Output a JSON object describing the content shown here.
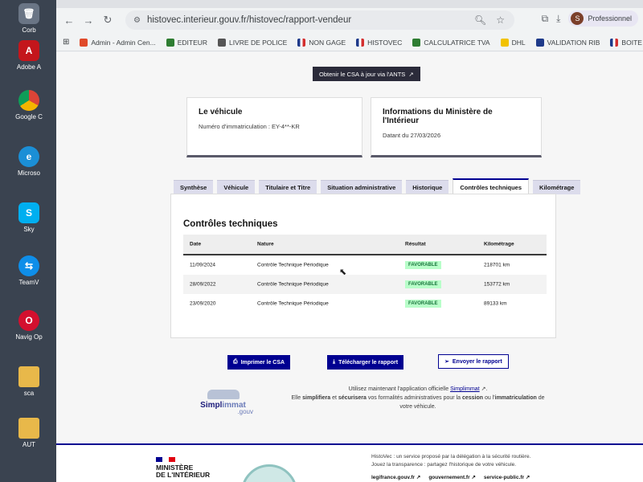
{
  "desktop": {
    "items": [
      {
        "label": "Corb",
        "icon": "trash-icon"
      },
      {
        "label": "Adobe A",
        "icon": "acrobat-icon"
      },
      {
        "label": "Google C",
        "icon": "chrome-icon"
      },
      {
        "label": "Microso",
        "icon": "edge-icon"
      },
      {
        "label": "Sky",
        "icon": "skype-icon"
      },
      {
        "label": "TeamV",
        "icon": "teamviewer-icon"
      },
      {
        "label": "Navig Op",
        "icon": "opera-icon"
      },
      {
        "label": "sca",
        "icon": "folder-icon"
      },
      {
        "label": "AUT",
        "icon": "folder-icon"
      }
    ]
  },
  "browser": {
    "url": "histovec.interieur.gouv.fr/histovec/rapport-vendeur",
    "profile_label": "Professionnel",
    "profile_initial": "S",
    "bookmarks": [
      {
        "label": "Admin - Admin Cen...",
        "color": "#e04a2a"
      },
      {
        "label": "EDITEUR",
        "color": "#2e7d32"
      },
      {
        "label": "LIVRE DE POLICE",
        "color": "#555555"
      },
      {
        "label": "NON GAGE",
        "color": "#1e3a8a"
      },
      {
        "label": "HISTOVEC",
        "color": "#1e3a8a"
      },
      {
        "label": "CALCULATRICE TVA",
        "color": "#2e7d32"
      },
      {
        "label": "DHL",
        "color": "#f2c200"
      },
      {
        "label": "VALIDATION RIB",
        "color": "#1e3a8a"
      },
      {
        "label": "BOITE A OUTILS",
        "color": "#1e3a8a"
      }
    ]
  },
  "page": {
    "csa_button": "Obtenir le CSA à jour via l'ANTS",
    "vehicle_card": {
      "title": "Le véhicule",
      "text": "Numéro d'immatriculation : EY-4**-KR"
    },
    "ministry_card": {
      "title": "Informations du Ministère de l'Intérieur",
      "text": "Datant du 27/03/2026"
    },
    "tabs": [
      {
        "label": "Synthèse",
        "active": false
      },
      {
        "label": "Véhicule",
        "active": false
      },
      {
        "label": "Titulaire et Titre",
        "active": false
      },
      {
        "label": "Situation administrative",
        "active": false
      },
      {
        "label": "Historique",
        "active": false
      },
      {
        "label": "Contrôles techniques",
        "active": true
      },
      {
        "label": "Kilométrage",
        "active": false
      }
    ],
    "ct": {
      "heading": "Contrôles techniques",
      "headers": {
        "date": "Date",
        "nature": "Nature",
        "result": "Résultat",
        "km": "Kilométrage"
      },
      "rows": [
        {
          "date": "11/09/2024",
          "nature": "Contrôle Technique Périodique",
          "result": "FAVORABLE",
          "km": "218701 km"
        },
        {
          "date": "28/09/2022",
          "nature": "Contrôle Technique Périodique",
          "result": "FAVORABLE",
          "km": "153772 km"
        },
        {
          "date": "23/09/2020",
          "nature": "Contrôle Technique Périodique",
          "result": "FAVORABLE",
          "km": "89133 km"
        }
      ]
    },
    "actions": {
      "print": "Imprimer le CSA",
      "download": "Télécharger le rapport",
      "send": "Envoyer le rapport"
    },
    "simplimmat": {
      "logo_main": "Simpl",
      "logo_accent": "immat",
      "logo_suffix": ".gouv",
      "line1_pre": "Utilisez maintenant l'application officielle ",
      "line1_link": "Simplimmat",
      "line1_post": ".",
      "line2_a": "Elle ",
      "line2_b": "simplifiera",
      "line2_c": " et ",
      "line2_d": "sécurisera",
      "line2_e": " vos formalités administratives pour la ",
      "line2_f": "cession",
      "line2_g": " ou l'",
      "line2_h": "immatriculation",
      "line2_i": " de",
      "line3": "votre véhicule."
    },
    "footer": {
      "ministry_line1": "MINISTÈRE",
      "ministry_line2": "DE L'INTÉRIEUR",
      "desc1": "HistoVec : un service proposé par la délégation à la sécurité routière.",
      "desc2": "Jouez la transparence : partagez l'historique de votre véhicule.",
      "links": [
        "legifrance.gouv.fr",
        "gouvernement.fr",
        "service-public.fr"
      ]
    }
  }
}
